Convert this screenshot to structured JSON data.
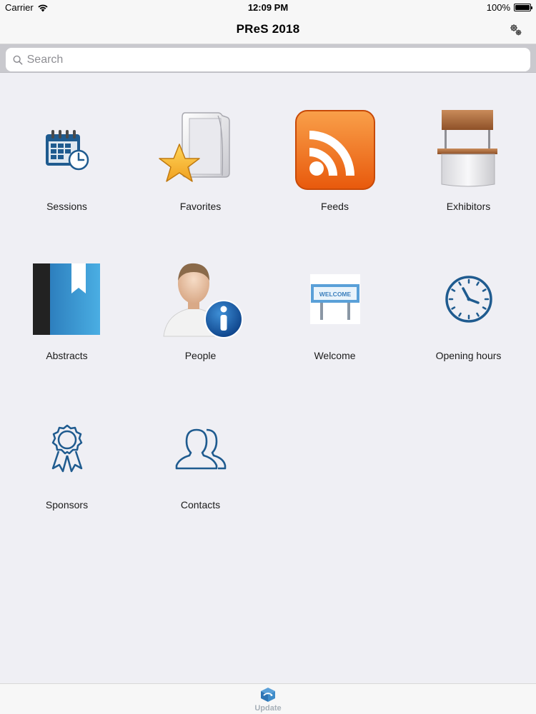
{
  "status_bar": {
    "carrier": "Carrier",
    "time": "12:09 PM",
    "battery": "100%"
  },
  "nav": {
    "title": "PReS 2018",
    "settings_icon": "gears-icon"
  },
  "search": {
    "placeholder": "Search"
  },
  "tiles": [
    {
      "label": "Sessions",
      "icon": "calendar-clock-icon"
    },
    {
      "label": "Favorites",
      "icon": "folder-star-icon"
    },
    {
      "label": "Feeds",
      "icon": "rss-icon"
    },
    {
      "label": "Exhibitors",
      "icon": "booth-icon"
    },
    {
      "label": "Abstracts",
      "icon": "book-bookmark-icon"
    },
    {
      "label": "People",
      "icon": "person-info-icon"
    },
    {
      "label": "Welcome",
      "icon": "welcome-sign-icon"
    },
    {
      "label": "Opening hours",
      "icon": "clock-icon"
    },
    {
      "label": "Sponsors",
      "icon": "ribbon-award-icon"
    },
    {
      "label": "Contacts",
      "icon": "users-icon"
    }
  ],
  "welcome_sign_text": "WELCOME",
  "tab_bar": {
    "update_label": "Update"
  },
  "colors": {
    "accent_blue": "#1f5b8f",
    "feeds_orange": "#f27b1c",
    "tab_inactive": "#a7b0b8"
  }
}
